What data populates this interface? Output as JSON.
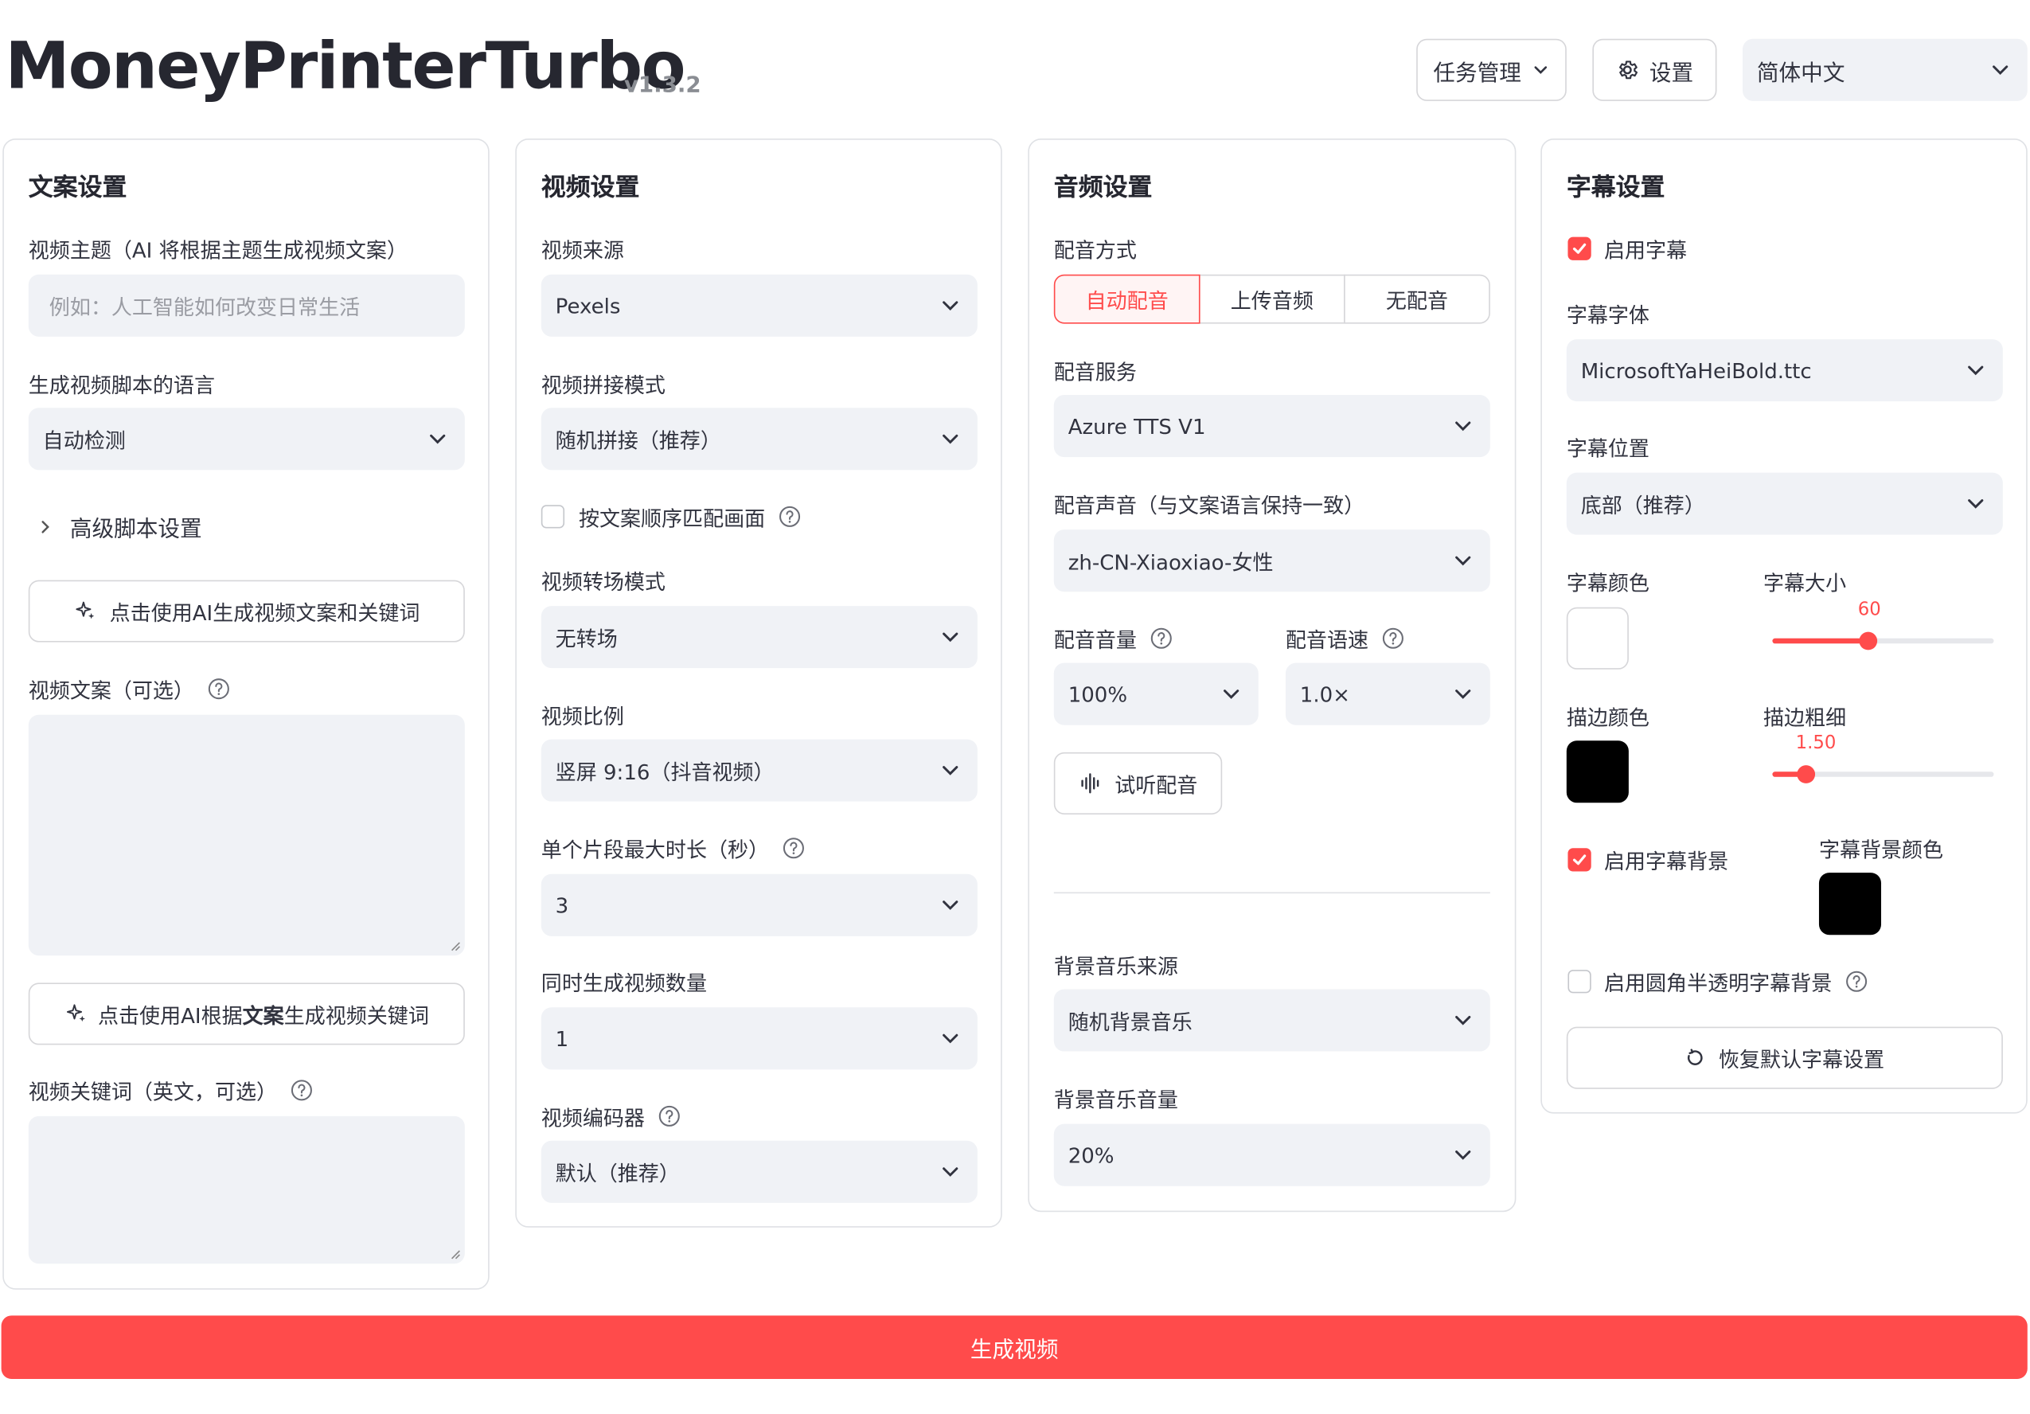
{
  "app": {
    "title": "MoneyPrinterTurbo",
    "version": "v1.3.2"
  },
  "header": {
    "tasks_label": "任务管理",
    "settings_label": "设置",
    "language": "简体中文"
  },
  "script_panel": {
    "title": "文案设置",
    "subject_label": "视频主题（AI 将根据主题生成视频文案）",
    "subject_placeholder": "例如：人工智能如何改变日常生活",
    "lang_label": "生成视频脚本的语言",
    "lang_value": "自动检测",
    "advanced_label": "高级脚本设置",
    "gen_script_button": "点击使用AI生成视频文案和关键词",
    "script_label": "视频文案（可选）",
    "gen_keywords_prefix": "点击使用AI根据",
    "gen_keywords_bold": "文案",
    "gen_keywords_suffix": "生成视频关键词",
    "keywords_label": "视频关键词（英文，可选）"
  },
  "video_panel": {
    "title": "视频设置",
    "source_label": "视频来源",
    "source_value": "Pexels",
    "concat_label": "视频拼接模式",
    "concat_value": "随机拼接（推荐）",
    "match_label": "按文案顺序匹配画面",
    "transition_label": "视频转场模式",
    "transition_value": "无转场",
    "ratio_label": "视频比例",
    "ratio_value": "竖屏 9:16（抖音视频）",
    "clip_label": "单个片段最大时长（秒）",
    "clip_value": "3",
    "count_label": "同时生成视频数量",
    "count_value": "1",
    "codec_label": "视频编码器",
    "codec_value": "默认（推荐）"
  },
  "audio_panel": {
    "title": "音频设置",
    "mode_label": "配音方式",
    "modes": [
      "自动配音",
      "上传音频",
      "无配音"
    ],
    "service_label": "配音服务",
    "service_value": "Azure TTS V1",
    "voice_label": "配音声音（与文案语言保持一致）",
    "voice_value": "zh-CN-Xiaoxiao-女性",
    "volume_label": "配音音量",
    "volume_value": "100%",
    "rate_label": "配音语速",
    "rate_value": "1.0×",
    "preview_button": "试听配音",
    "bgm_label": "背景音乐来源",
    "bgm_value": "随机背景音乐",
    "bgm_volume_label": "背景音乐音量",
    "bgm_volume_value": "20%"
  },
  "subtitle_panel": {
    "title": "字幕设置",
    "enable_label": "启用字幕",
    "font_label": "字幕字体",
    "font_value": "MicrosoftYaHeiBold.ttc",
    "position_label": "字幕位置",
    "position_value": "底部（推荐）",
    "color_label": "字幕颜色",
    "color_value": "#FFFFFF",
    "size_label": "字幕大小",
    "size_value": "60",
    "size_fraction": 0.43,
    "stroke_color_label": "描边颜色",
    "stroke_color_value": "#000000",
    "stroke_width_label": "描边粗细",
    "stroke_width_value": "1.50",
    "stroke_fraction": 0.15,
    "bg_enable_label": "启用字幕背景",
    "bg_color_label": "字幕背景颜色",
    "bg_color_value": "#000000",
    "rounded_label": "启用圆角半透明字幕背景",
    "reset_button": "恢复默认字幕设置"
  },
  "generate_button": "生成视频",
  "colors": {
    "accent": "#ff4b4b",
    "input_bg": "#f0f2f6"
  }
}
